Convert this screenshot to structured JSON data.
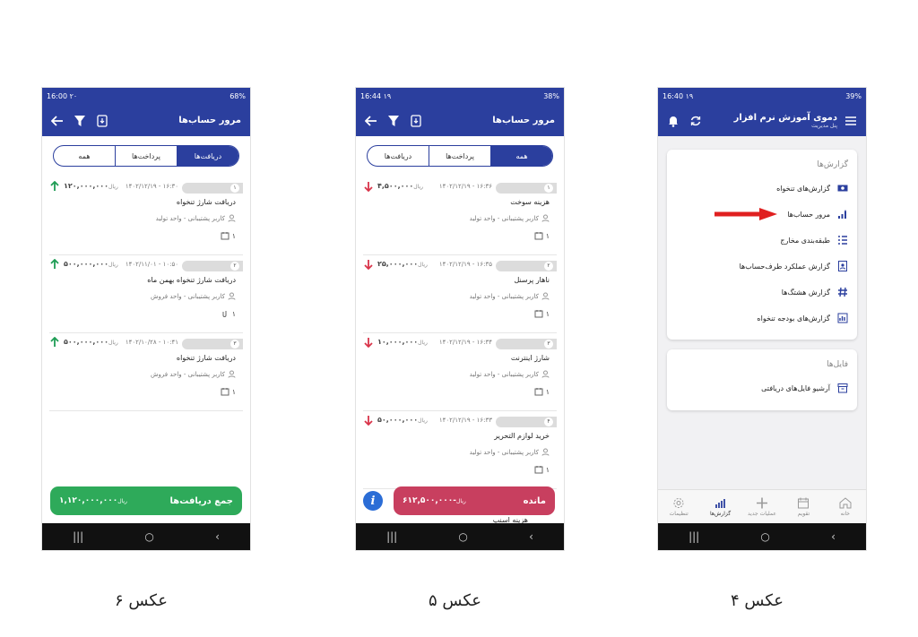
{
  "phone6": {
    "status": {
      "time": "16:00 ۲۰",
      "indicators": "68%"
    },
    "header": {
      "title": "مرور حساب‌ها"
    },
    "tabs": [
      "همه",
      "پرداخت‌ها",
      "دریافت‌ها"
    ],
    "active_tab": 2,
    "rows": [
      {
        "num": "۱",
        "datetime": "۱۶:۳۰ - ۱۴۰۲/۱۲/۱۹",
        "amount": "۱۲۰,۰۰۰,۰۰۰",
        "currency": "ریال",
        "desc": "دریافت شارژ تنخواه",
        "user": "کاربر پشتیبانی - واحد تولید",
        "count": "۱"
      },
      {
        "num": "۲",
        "datetime": "۱۰:۵۰ - ۱۴۰۲/۱۱/۰۱",
        "amount": "۵۰۰,۰۰۰,۰۰۰",
        "currency": "ریال",
        "desc": "دریافت شارژ تنخواه بهمن ماه",
        "user": "کاربر پشتیبانی - واحد فروش",
        "count": "۱"
      },
      {
        "num": "۳",
        "datetime": "۱۰:۴۱ - ۱۴۰۲/۱۰/۲۸",
        "amount": "۵۰۰,۰۰۰,۰۰۰",
        "currency": "ریال",
        "desc": "دریافت شارژ تنخواه",
        "user": "کاربر پشتیبانی - واحد فروش",
        "count": "۱"
      }
    ],
    "summary": {
      "label": "جمع دریافت‌ها",
      "value": "۱,۱۲۰,۰۰۰,۰۰۰",
      "currency": "ریال"
    }
  },
  "phone5": {
    "status": {
      "time": "16:44 ۱۹",
      "indicators": "38%"
    },
    "header": {
      "title": "مرور حساب‌ها"
    },
    "tabs": [
      "همه",
      "پرداخت‌ها",
      "دریافت‌ها"
    ],
    "active_tab": 0,
    "rows": [
      {
        "num": "۱",
        "datetime": "۱۶:۳۶ - ۱۴۰۲/۱۲/۱۹",
        "amount": "۴,۵۰۰,۰۰۰",
        "currency": "ریال",
        "desc": "هزینه سوخت",
        "user": "کاربر پشتیبانی - واحد تولید",
        "count": "۱"
      },
      {
        "num": "۲",
        "datetime": "۱۶:۳۵ - ۱۴۰۲/۱۲/۱۹",
        "amount": "۲۵,۰۰۰,۰۰۰",
        "currency": "ریال",
        "desc": "ناهار پرسنل",
        "user": "کاربر پشتیبانی - واحد تولید",
        "count": "۱"
      },
      {
        "num": "۳",
        "datetime": "۱۶:۳۴ - ۱۴۰۲/۱۲/۱۹",
        "amount": "۱۰,۰۰۰,۰۰۰",
        "currency": "ریال",
        "desc": "شارژ اینترنت",
        "user": "کاربر پشتیبانی - واحد تولید",
        "count": "۱"
      },
      {
        "num": "۴",
        "datetime": "۱۶:۳۳ - ۱۴۰۲/۱۲/۱۹",
        "amount": "۵۰,۰۰۰,۰۰۰",
        "currency": "ریال",
        "desc": "خرید لوازم التحریر",
        "user": "کاربر پشتیبانی - واحد تولید",
        "count": "۱"
      }
    ],
    "peek_text": "هزینه اسنپ",
    "summary": {
      "label": "مانده",
      "value": "-۶۱۲,۵۰۰,۰۰۰",
      "currency": "ریال"
    }
  },
  "phone4": {
    "status": {
      "time": "16:40 ۱۹",
      "indicators": "39%"
    },
    "header": {
      "title": "دموی آموزش نرم افزار",
      "subtitle": "پنل مدیریت"
    },
    "reports_card": {
      "title": "گزارش‌ها",
      "items": [
        "گزارش‌های تنخواه",
        "مرور حساب‌ها",
        "طبقه‌بندی مخارج",
        "گزارش عملکرد طرف‌حساب‌ها",
        "گزارش هشتگ‌ها",
        "گزارش‌های بودجه تنخواه"
      ]
    },
    "files_card": {
      "title": "فایل‌ها",
      "items": [
        "آرشیو فایل‌های دریافتی"
      ]
    },
    "bottom_nav": [
      "خانه",
      "تقویم",
      "عملیات جدید",
      "گزارش‌ها",
      "تنظیمات"
    ],
    "active_nav": 3
  },
  "captions": [
    "عکس ۶",
    "عکس ۵",
    "عکس ۴"
  ],
  "colors": {
    "primary": "#2b3f9e",
    "green": "#2eaa5a",
    "red": "#c83f5f",
    "arrow_up": "#1f9d55",
    "arrow_down": "#d9344a"
  }
}
